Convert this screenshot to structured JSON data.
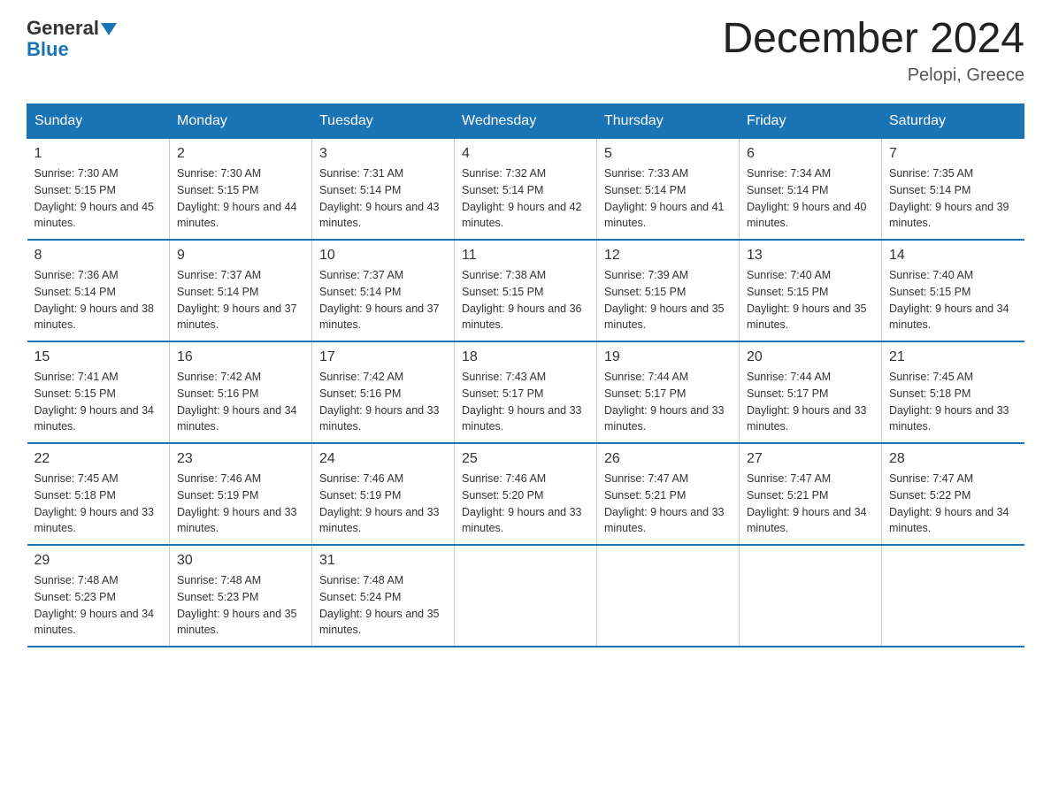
{
  "header": {
    "logo_general": "General",
    "logo_blue": "Blue",
    "month_title": "December 2024",
    "location": "Pelopi, Greece"
  },
  "days_of_week": [
    "Sunday",
    "Monday",
    "Tuesday",
    "Wednesday",
    "Thursday",
    "Friday",
    "Saturday"
  ],
  "weeks": [
    [
      {
        "day": "1",
        "sunrise": "7:30 AM",
        "sunset": "5:15 PM",
        "daylight": "9 hours and 45 minutes."
      },
      {
        "day": "2",
        "sunrise": "7:30 AM",
        "sunset": "5:15 PM",
        "daylight": "9 hours and 44 minutes."
      },
      {
        "day": "3",
        "sunrise": "7:31 AM",
        "sunset": "5:14 PM",
        "daylight": "9 hours and 43 minutes."
      },
      {
        "day": "4",
        "sunrise": "7:32 AM",
        "sunset": "5:14 PM",
        "daylight": "9 hours and 42 minutes."
      },
      {
        "day": "5",
        "sunrise": "7:33 AM",
        "sunset": "5:14 PM",
        "daylight": "9 hours and 41 minutes."
      },
      {
        "day": "6",
        "sunrise": "7:34 AM",
        "sunset": "5:14 PM",
        "daylight": "9 hours and 40 minutes."
      },
      {
        "day": "7",
        "sunrise": "7:35 AM",
        "sunset": "5:14 PM",
        "daylight": "9 hours and 39 minutes."
      }
    ],
    [
      {
        "day": "8",
        "sunrise": "7:36 AM",
        "sunset": "5:14 PM",
        "daylight": "9 hours and 38 minutes."
      },
      {
        "day": "9",
        "sunrise": "7:37 AM",
        "sunset": "5:14 PM",
        "daylight": "9 hours and 37 minutes."
      },
      {
        "day": "10",
        "sunrise": "7:37 AM",
        "sunset": "5:14 PM",
        "daylight": "9 hours and 37 minutes."
      },
      {
        "day": "11",
        "sunrise": "7:38 AM",
        "sunset": "5:15 PM",
        "daylight": "9 hours and 36 minutes."
      },
      {
        "day": "12",
        "sunrise": "7:39 AM",
        "sunset": "5:15 PM",
        "daylight": "9 hours and 35 minutes."
      },
      {
        "day": "13",
        "sunrise": "7:40 AM",
        "sunset": "5:15 PM",
        "daylight": "9 hours and 35 minutes."
      },
      {
        "day": "14",
        "sunrise": "7:40 AM",
        "sunset": "5:15 PM",
        "daylight": "9 hours and 34 minutes."
      }
    ],
    [
      {
        "day": "15",
        "sunrise": "7:41 AM",
        "sunset": "5:15 PM",
        "daylight": "9 hours and 34 minutes."
      },
      {
        "day": "16",
        "sunrise": "7:42 AM",
        "sunset": "5:16 PM",
        "daylight": "9 hours and 34 minutes."
      },
      {
        "day": "17",
        "sunrise": "7:42 AM",
        "sunset": "5:16 PM",
        "daylight": "9 hours and 33 minutes."
      },
      {
        "day": "18",
        "sunrise": "7:43 AM",
        "sunset": "5:17 PM",
        "daylight": "9 hours and 33 minutes."
      },
      {
        "day": "19",
        "sunrise": "7:44 AM",
        "sunset": "5:17 PM",
        "daylight": "9 hours and 33 minutes."
      },
      {
        "day": "20",
        "sunrise": "7:44 AM",
        "sunset": "5:17 PM",
        "daylight": "9 hours and 33 minutes."
      },
      {
        "day": "21",
        "sunrise": "7:45 AM",
        "sunset": "5:18 PM",
        "daylight": "9 hours and 33 minutes."
      }
    ],
    [
      {
        "day": "22",
        "sunrise": "7:45 AM",
        "sunset": "5:18 PM",
        "daylight": "9 hours and 33 minutes."
      },
      {
        "day": "23",
        "sunrise": "7:46 AM",
        "sunset": "5:19 PM",
        "daylight": "9 hours and 33 minutes."
      },
      {
        "day": "24",
        "sunrise": "7:46 AM",
        "sunset": "5:19 PM",
        "daylight": "9 hours and 33 minutes."
      },
      {
        "day": "25",
        "sunrise": "7:46 AM",
        "sunset": "5:20 PM",
        "daylight": "9 hours and 33 minutes."
      },
      {
        "day": "26",
        "sunrise": "7:47 AM",
        "sunset": "5:21 PM",
        "daylight": "9 hours and 33 minutes."
      },
      {
        "day": "27",
        "sunrise": "7:47 AM",
        "sunset": "5:21 PM",
        "daylight": "9 hours and 34 minutes."
      },
      {
        "day": "28",
        "sunrise": "7:47 AM",
        "sunset": "5:22 PM",
        "daylight": "9 hours and 34 minutes."
      }
    ],
    [
      {
        "day": "29",
        "sunrise": "7:48 AM",
        "sunset": "5:23 PM",
        "daylight": "9 hours and 34 minutes."
      },
      {
        "day": "30",
        "sunrise": "7:48 AM",
        "sunset": "5:23 PM",
        "daylight": "9 hours and 35 minutes."
      },
      {
        "day": "31",
        "sunrise": "7:48 AM",
        "sunset": "5:24 PM",
        "daylight": "9 hours and 35 minutes."
      },
      null,
      null,
      null,
      null
    ]
  ]
}
